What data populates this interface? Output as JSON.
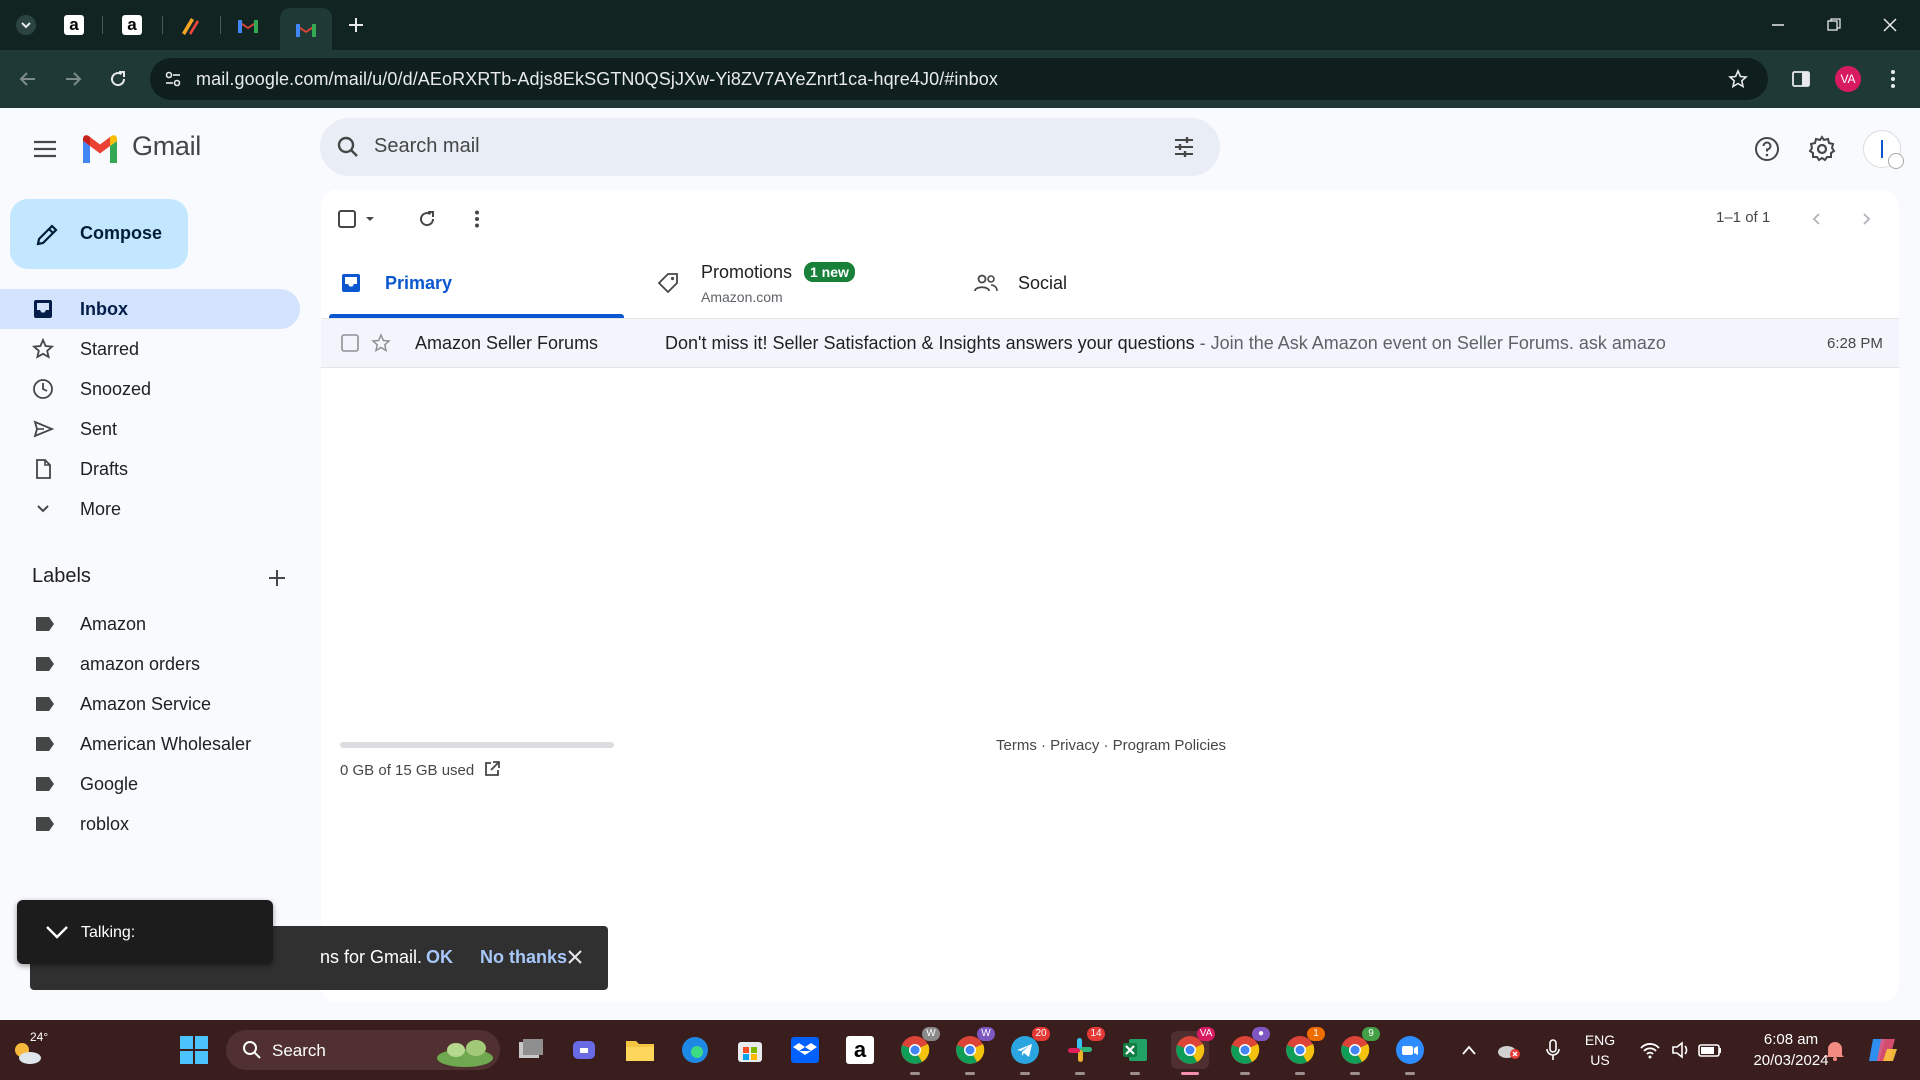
{
  "browser": {
    "url": "mail.google.com/mail/u/0/d/AEoRXRTb-Adjs8EkSGTN0QSjJXw-Yi8ZV7AYeZnrt1ca-hqre4J0/#inbox",
    "profile_initials": "VA",
    "tabs": [
      {
        "name": "tab-amazon-1",
        "icon": "amazon-icon"
      },
      {
        "name": "tab-amazon-2",
        "icon": "amazon-icon"
      },
      {
        "name": "tab-tool",
        "icon": "tool-icon"
      },
      {
        "name": "tab-gmail-1",
        "icon": "gmail-icon"
      },
      {
        "name": "tab-gmail-2",
        "icon": "gmail-icon",
        "active": true
      }
    ]
  },
  "gmail": {
    "app_name": "Gmail",
    "search_placeholder": "Search mail",
    "compose_label": "Compose",
    "nav": {
      "inbox": "Inbox",
      "starred": "Starred",
      "snoozed": "Snoozed",
      "sent": "Sent",
      "drafts": "Drafts",
      "more": "More"
    },
    "labels_heading": "Labels",
    "labels": [
      "Amazon",
      "amazon orders",
      "Amazon Service",
      "American Wholesaler",
      "Google",
      "roblox"
    ],
    "page_count": "1–1 of 1",
    "tabs": {
      "primary": "Primary",
      "promotions": "Promotions",
      "promotions_badge": "1 new",
      "promotions_sub": "Amazon.com",
      "social": "Social"
    },
    "email": {
      "sender": "Amazon Seller Forums",
      "subject": "Don't miss it! Seller Satisfaction & Insights answers your questions",
      "snippet": " - Join the Ask Amazon event on Seller Forums. ask amazon event imag...",
      "time": "6:28 PM"
    },
    "storage": "0 GB of 15 GB used",
    "footer": "Terms · Privacy · Program Policies"
  },
  "snackbar": {
    "message": "ns for Gmail.",
    "ok": "OK",
    "no_thanks": "No thanks"
  },
  "talking": {
    "label": "Talking:"
  },
  "taskbar": {
    "weather": "24°",
    "search": "Search",
    "lang": "ENG",
    "region": "US",
    "time": "6:08 am",
    "date": "20/03/2024",
    "badges": {
      "telegram": "20",
      "slack": "14",
      "chrome_va": "VA",
      "chrome_w1": "W",
      "chrome_w2": "W",
      "chrome_1": "1",
      "chrome_9": "9"
    }
  },
  "colors": {
    "gmail_red": "#ea4335",
    "accent": "#0b57d0",
    "badge_green": "#188038"
  }
}
